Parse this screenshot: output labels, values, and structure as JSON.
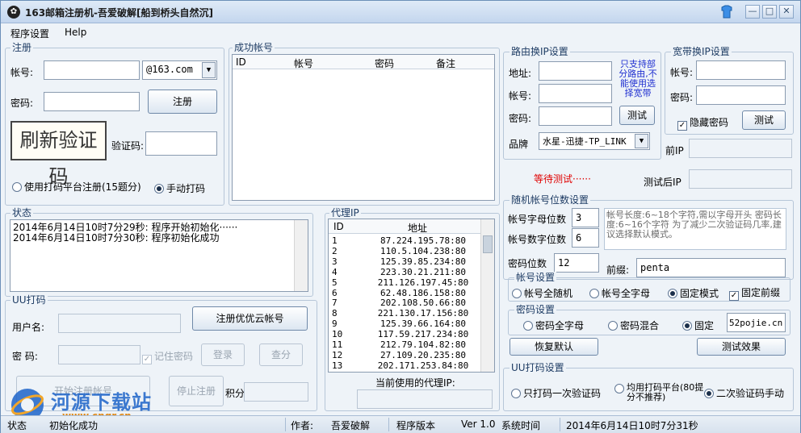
{
  "window": {
    "title": "163邮箱注册机-吾爱破解[船到桥头自然沉]",
    "app_icon": "✿"
  },
  "menu": {
    "settings": "程序设置",
    "help": "Help"
  },
  "register": {
    "group": "注册",
    "account_label": "帐号:",
    "account_value": "",
    "domain": "@163.com",
    "password_label": "密码:",
    "password_value": "",
    "register_button": "注册",
    "refresh_captcha": "刷新验证码",
    "captcha_label": "验证码:",
    "captcha_value": "",
    "opt_platform": "使用打码平台注册(15题分)",
    "opt_manual": "手动打码"
  },
  "success": {
    "group": "成功帐号",
    "headers": [
      "ID",
      "帐号",
      "密码",
      "备注"
    ]
  },
  "router": {
    "group": "路由换IP设置",
    "addr_label": "地址:",
    "acct_label": "帐号:",
    "pwd_label": "密码:",
    "brand_label": "品牌",
    "brand_value": "水星-迅捷-TP_LINK",
    "test_button": "测试",
    "note": "只支持部分路由,不能使用选择宽带",
    "waiting": "等待测试······"
  },
  "broadband": {
    "group": "宽带换IP设置",
    "acct_label": "帐号:",
    "pwd_label": "密码:",
    "hide_pwd": "隐藏密码",
    "test_button": "测试",
    "prev_ip_label": "前IP",
    "after_ip_label": "测试后IP"
  },
  "status": {
    "group": "状态",
    "lines": [
      "2014年6月14日10时7分29秒: 程序开始初始化······",
      "2014年6月14日10时7分30秒: 程序初始化成功"
    ]
  },
  "proxy": {
    "group": "代理IP",
    "headers": [
      "ID",
      "地址"
    ],
    "rows": [
      [
        "1",
        "87.224.195.78:80"
      ],
      [
        "2",
        "110.5.104.238:80"
      ],
      [
        "3",
        "125.39.85.234:80"
      ],
      [
        "4",
        "223.30.21.211:80"
      ],
      [
        "5",
        "211.126.197.45:80"
      ],
      [
        "6",
        "62.48.186.158:80"
      ],
      [
        "7",
        "202.108.50.66:80"
      ],
      [
        "8",
        "221.130.17.156:80"
      ],
      [
        "9",
        "125.39.66.164:80"
      ],
      [
        "10",
        "117.59.217.234:80"
      ],
      [
        "11",
        "212.79.104.82:80"
      ],
      [
        "12",
        "27.109.20.235:80"
      ],
      [
        "13",
        "202.171.253.84:80"
      ]
    ],
    "current_label": "当前使用的代理IP:"
  },
  "uu": {
    "group": "UU打码",
    "user_label": "用户名:",
    "pwd_label": "密 码:",
    "remember": "记住密码",
    "register_button": "注册优优云帐号",
    "login_button": "登录",
    "query_button": "查分",
    "start_button": "开始注册帐号",
    "stop_button": "停止注册",
    "points_label": "积分"
  },
  "random": {
    "group": "随机帐号位数设置",
    "letters_label": "帐号字母位数",
    "letters_value": "3",
    "digits_label": "帐号数字位数",
    "digits_value": "6",
    "pwd_len_label": "密码位数",
    "pwd_len_value": "12",
    "prefix_label": "前缀:",
    "prefix_value": "penta",
    "note": "帐号长度:6~18个字符,需以字母开头 密码长度:6~16个字符 为了减少二次验证码几率,建议选择默认模式。"
  },
  "account_set": {
    "group": "帐号设置",
    "opt_random": "帐号全随机",
    "opt_letters": "帐号全字母",
    "opt_fixed": "固定模式",
    "fixed_prefix": "固定前缀"
  },
  "password_set": {
    "group": "密码设置",
    "opt_letters": "密码全字母",
    "opt_mixed": "密码混合",
    "opt_fixed": "固定",
    "fixed_value": "52pojie.cn"
  },
  "actions": {
    "reset": "恢复默认",
    "test": "测试效果"
  },
  "uu_set": {
    "group": "UU打码设置",
    "opt_once": "只打码一次验证码",
    "opt_platform": "均用打码平台(80提分不推荐)",
    "opt_second": "二次验证码手动"
  },
  "statusbar": {
    "state_label": "状态",
    "state_value": "初始化成功",
    "author_label": "作者:",
    "author_value": "吾爱破解",
    "version_label": "程序版本",
    "version_value": "Ver 1.0",
    "time_label": "系统时间",
    "time_value": "2014年6月14日10时7分31秒"
  },
  "watermark": {
    "brand": "河源下载站",
    "url": "www.cngr.cn"
  },
  "colors": {
    "accent": "#2a5fb5",
    "waiting": "#e00000",
    "note": "#1f2fd0"
  }
}
